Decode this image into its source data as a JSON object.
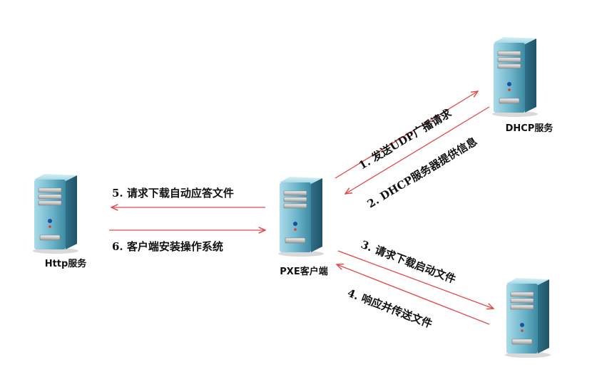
{
  "colors": {
    "arrow": "#e04a4a",
    "server_light": "#a9dbe8",
    "server_mid": "#5fa8c0",
    "server_dark": "#2f6f86",
    "label_text": "#111111"
  },
  "servers": {
    "dhcp": {
      "label": "DHCP服务",
      "icon": "server-tower-icon"
    },
    "http": {
      "label": "Http服务",
      "icon": "server-tower-icon"
    },
    "pxe_client": {
      "label": "PXE客户端",
      "icon": "server-tower-icon"
    },
    "tftp": {
      "label": "",
      "icon": "server-tower-icon"
    }
  },
  "steps": [
    {
      "label": "1. 发送UDP广播请求"
    },
    {
      "label": "2. DHCP服务器提供信息"
    },
    {
      "label": "3. 请求下载启动文件"
    },
    {
      "label": "4. 响应并传送文件"
    },
    {
      "label": "5. 请求下载自动应答文件"
    },
    {
      "label": "6. 客户端安装操作系统"
    }
  ]
}
